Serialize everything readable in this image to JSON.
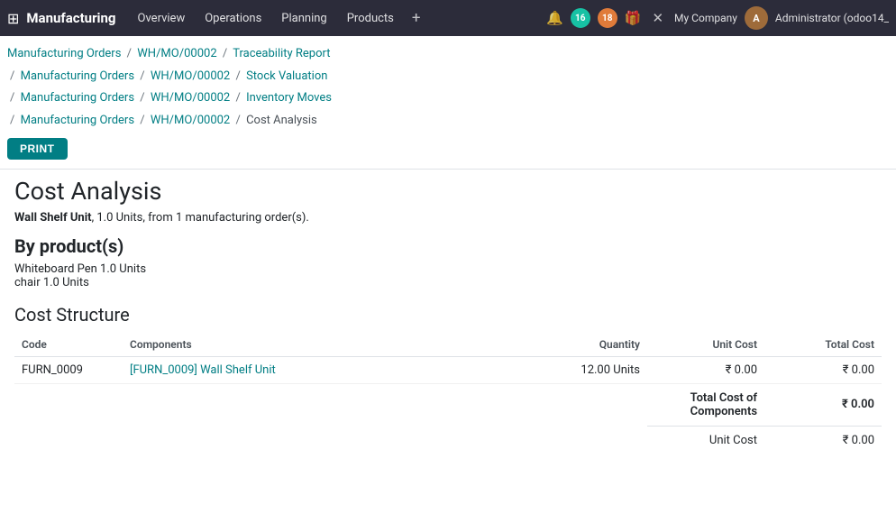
{
  "nav": {
    "brand": "Manufacturing",
    "menu_items": [
      "Overview",
      "Operations",
      "Planning",
      "Products"
    ],
    "plus_label": "+",
    "badge_16": "16",
    "badge_18": "18",
    "company": "My Company",
    "user": "Administrator (odoo14_",
    "avatar_initials": "A"
  },
  "breadcrumbs": [
    {
      "lines": [
        {
          "text": "Manufacturing Orders",
          "link": true
        },
        {
          "text": "/",
          "link": false
        },
        {
          "text": "WH/MO/00002",
          "link": true
        },
        {
          "text": "/",
          "link": false
        },
        {
          "text": "Traceability Report",
          "link": true
        }
      ]
    },
    {
      "lines": [
        {
          "text": "/",
          "link": false
        },
        {
          "text": "Manufacturing Orders",
          "link": true
        },
        {
          "text": "/",
          "link": false
        },
        {
          "text": "WH/MO/00002",
          "link": true
        },
        {
          "text": "/",
          "link": false
        },
        {
          "text": "Stock Valuation",
          "link": true
        }
      ]
    },
    {
      "lines": [
        {
          "text": "/",
          "link": false
        },
        {
          "text": "Manufacturing Orders",
          "link": true
        },
        {
          "text": "/",
          "link": false
        },
        {
          "text": "WH/MO/00002",
          "link": true
        },
        {
          "text": "/",
          "link": false
        },
        {
          "text": "Inventory Moves",
          "link": true
        }
      ]
    },
    {
      "lines": [
        {
          "text": "/",
          "link": false
        },
        {
          "text": "Manufacturing Orders",
          "link": true
        },
        {
          "text": "/",
          "link": false
        },
        {
          "text": "WH/MO/00002",
          "link": true
        },
        {
          "text": "/",
          "link": false
        },
        {
          "text": "Cost Analysis",
          "link": false
        }
      ]
    }
  ],
  "print_button": "PRINT",
  "page_title": "Cost Analysis",
  "subtitle_product": "Wall Shelf Unit",
  "subtitle_rest": ", 1.0 Units, from 1 manufacturing order(s).",
  "by_products_title": "By product(s)",
  "by_products": [
    "Whiteboard Pen 1.0 Units",
    "chair 1.0 Units"
  ],
  "cost_structure_title": "Cost Structure",
  "table": {
    "headers": [
      "Code",
      "Components",
      "Quantity",
      "Unit Cost",
      "Total Cost"
    ],
    "rows": [
      {
        "code": "FURN_0009",
        "component": "[FURN_0009] Wall Shelf Unit",
        "quantity": "12.00 Units",
        "unit_cost": "₹ 0.00",
        "total_cost": "₹ 0.00"
      }
    ],
    "total_components_label": "Total Cost of Components",
    "total_components_value": "₹ 0.00",
    "unit_cost_label": "Unit Cost",
    "unit_cost_value": "₹ 0.00"
  }
}
